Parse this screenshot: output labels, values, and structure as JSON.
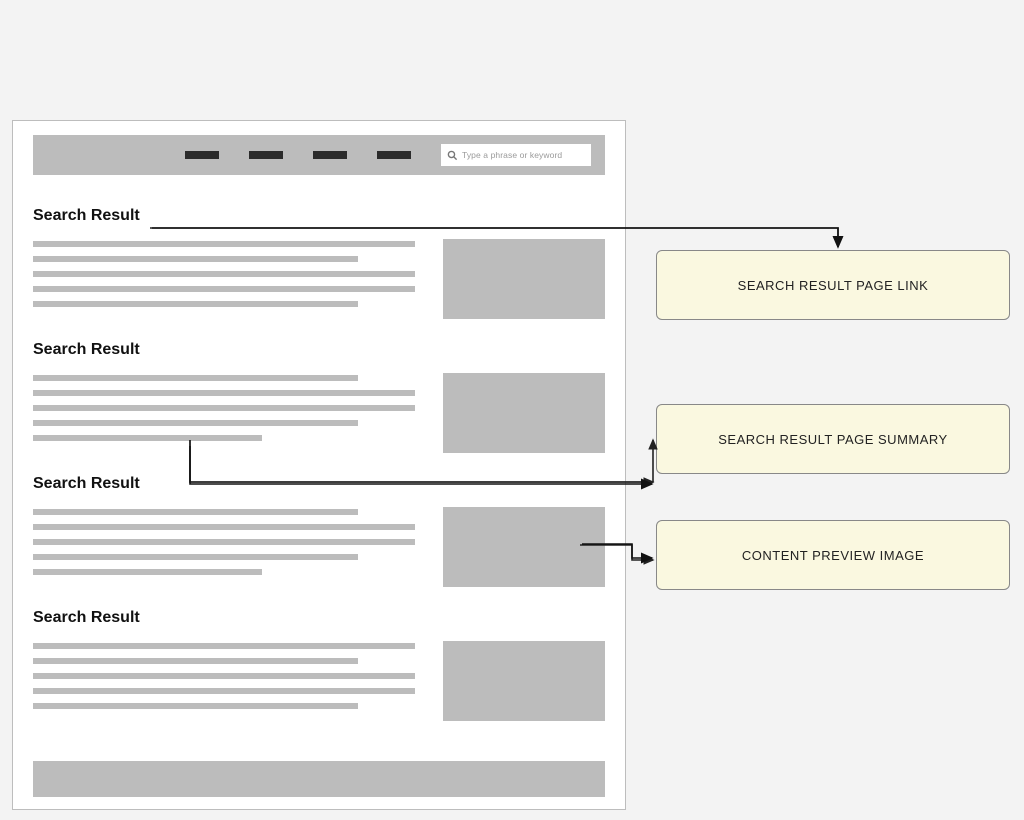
{
  "search": {
    "placeholder": "Type a phrase or keyword"
  },
  "results": [
    {
      "title": "Search Result"
    },
    {
      "title": "Search Result"
    },
    {
      "title": "Search Result"
    },
    {
      "title": "Search Result"
    }
  ],
  "callouts": {
    "link": "SEARCH RESULT PAGE LINK",
    "summary": "SEARCH RESULT PAGE SUMMARY",
    "image": "CONTENT PREVIEW IMAGE"
  }
}
